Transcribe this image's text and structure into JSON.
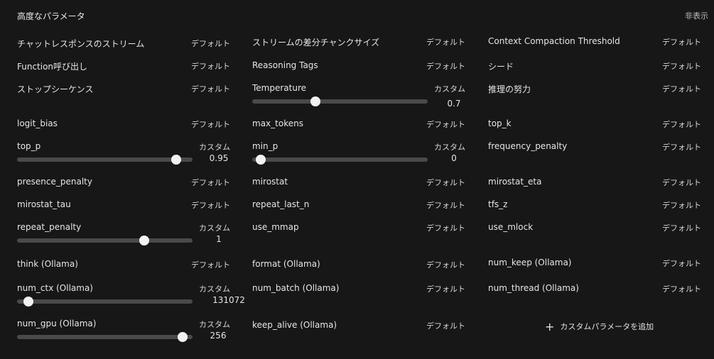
{
  "header": {
    "title": "高度なパラメータ",
    "hide_label": "非表示"
  },
  "params": {
    "p0": {
      "name": "チャットレスポンスのストリーム",
      "state": "デフォルト"
    },
    "p1": {
      "name": "ストリームの差分チャンクサイズ",
      "state": "デフォルト"
    },
    "p2": {
      "name": "Context Compaction Threshold",
      "state": "デフォルト"
    },
    "p3": {
      "name": "Function呼び出し",
      "state": "デフォルト"
    },
    "p4": {
      "name": "Reasoning Tags",
      "state": "デフォルト"
    },
    "p5": {
      "name": "シード",
      "state": "デフォルト"
    },
    "p6": {
      "name": "ストップシーケンス",
      "state": "デフォルト"
    },
    "p7": {
      "name": "Temperature",
      "state": "カスタム",
      "value": "0.7",
      "fill": 0.35
    },
    "p8": {
      "name": "推理の努力",
      "state": "デフォルト"
    },
    "p9": {
      "name": "logit_bias",
      "state": "デフォルト"
    },
    "p10": {
      "name": "max_tokens",
      "state": "デフォルト"
    },
    "p11": {
      "name": "top_k",
      "state": "デフォルト"
    },
    "p12": {
      "name": "top_p",
      "state": "カスタム",
      "value": "0.95",
      "fill": 0.93
    },
    "p13": {
      "name": "min_p",
      "state": "カスタム",
      "value": "0",
      "fill": 0.02
    },
    "p14": {
      "name": "frequency_penalty",
      "state": "デフォルト"
    },
    "p15": {
      "name": "presence_penalty",
      "state": "デフォルト"
    },
    "p16": {
      "name": "mirostat",
      "state": "デフォルト"
    },
    "p17": {
      "name": "mirostat_eta",
      "state": "デフォルト"
    },
    "p18": {
      "name": "mirostat_tau",
      "state": "デフォルト"
    },
    "p19": {
      "name": "repeat_last_n",
      "state": "デフォルト"
    },
    "p20": {
      "name": "tfs_z",
      "state": "デフォルト"
    },
    "p21": {
      "name": "repeat_penalty",
      "state": "カスタム",
      "value": "1",
      "fill": 0.74
    },
    "p22": {
      "name": "use_mmap",
      "state": "デフォルト"
    },
    "p23": {
      "name": "use_mlock",
      "state": "デフォルト"
    },
    "p24": {
      "name": "think (Ollama)",
      "state": "デフォルト"
    },
    "p25": {
      "name": "format (Ollama)",
      "state": "デフォルト"
    },
    "p26": {
      "name": "num_keep (Ollama)",
      "state": "デフォルト"
    },
    "p27": {
      "name": "num_ctx (Ollama)",
      "state": "カスタム",
      "value": "131072",
      "fill": 0.04
    },
    "p28": {
      "name": "num_batch (Ollama)",
      "state": "デフォルト"
    },
    "p29": {
      "name": "num_thread (Ollama)",
      "state": "デフォルト"
    },
    "p30": {
      "name": "num_gpu (Ollama)",
      "state": "カスタム",
      "value": "256",
      "fill": 0.97
    },
    "p31": {
      "name": "keep_alive (Ollama)",
      "state": "デフォルト"
    }
  },
  "add_custom": {
    "label": "カスタムパラメータを追加",
    "icon": "plus-icon"
  }
}
